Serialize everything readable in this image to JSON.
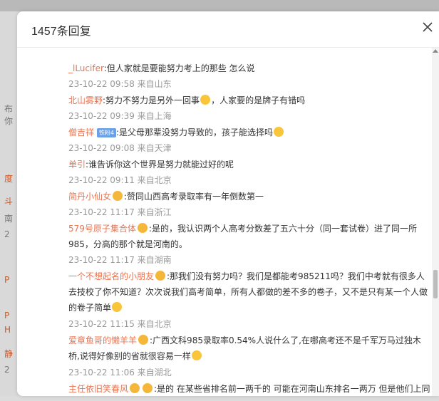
{
  "background": {
    "left_glyphs": [
      "布你",
      "度",
      "斗",
      "南",
      "2",
      "P",
      "P",
      "H",
      "静",
      "2"
    ]
  },
  "modal": {
    "title": "1457条回复",
    "close_icon": "close-icon"
  },
  "comments": [
    {
      "name": "_lLucifer",
      "text": ":但人家就是要能努力考上的那些 怎么说",
      "meta": "23-10-22 09:58 来自山东"
    },
    {
      "name": "北山雾野",
      "text": ":努力不努力是另外一回事",
      "emoji_after": true,
      "text2": "，人家要的是牌子有错吗",
      "meta": "23-10-22 09:39 来自上海"
    },
    {
      "name": "僧吉祥",
      "tag": "铁粉4",
      "text": ":是父母那辈没努力导致的，孩子能选择吗",
      "emoji_end": true,
      "meta": "23-10-22 09:08 来自天津"
    },
    {
      "name": "单引",
      "text": ":谁告诉你这个世界是努力就能过好的呢",
      "meta": "23-10-22 09:11 来自北京"
    },
    {
      "name": "简丹小仙女",
      "badge": true,
      "text": ":赞同山西高考录取率有一年倒数第一",
      "meta": "23-10-22 11:17 来自浙江"
    },
    {
      "name": "579号原子集合体",
      "badge": true,
      "text": ":是的，我认识两个人高考分数差了五六十分（同一套试卷）进了同一所985，分高的那个就是河南的。",
      "meta": "23-10-22 11:17 来自湖南"
    },
    {
      "name": "一个不想起名的小朋友",
      "badge": true,
      "text": ":那我们没有努力吗？我们是都能考985211吗？我们中考就有很多人去技校了你不知道？次次说我们高考简单，所有人都做的差不多的卷子，又不是只有某一个人做的卷子简单",
      "emoji_end": true,
      "meta": "23-10-22 11:15 来自北京"
    },
    {
      "name": "爱章鱼哥的懒羊羊",
      "badge": true,
      "text": ":广西文科985录取率0.54%人说什么了,在哪高考还不是千军万马过独木桥,说得好像别的省就很容易一样",
      "emoji_end": true,
      "meta": "23-10-22 11:06 来自湖北"
    },
    {
      "name": "主任依旧笑春风",
      "badge": true,
      "badge2": true,
      "text": ":是的 在某些省排名前一两千的 可能在河南山东排名一两万 但是他们上同一所大学",
      "meta": ""
    }
  ]
}
